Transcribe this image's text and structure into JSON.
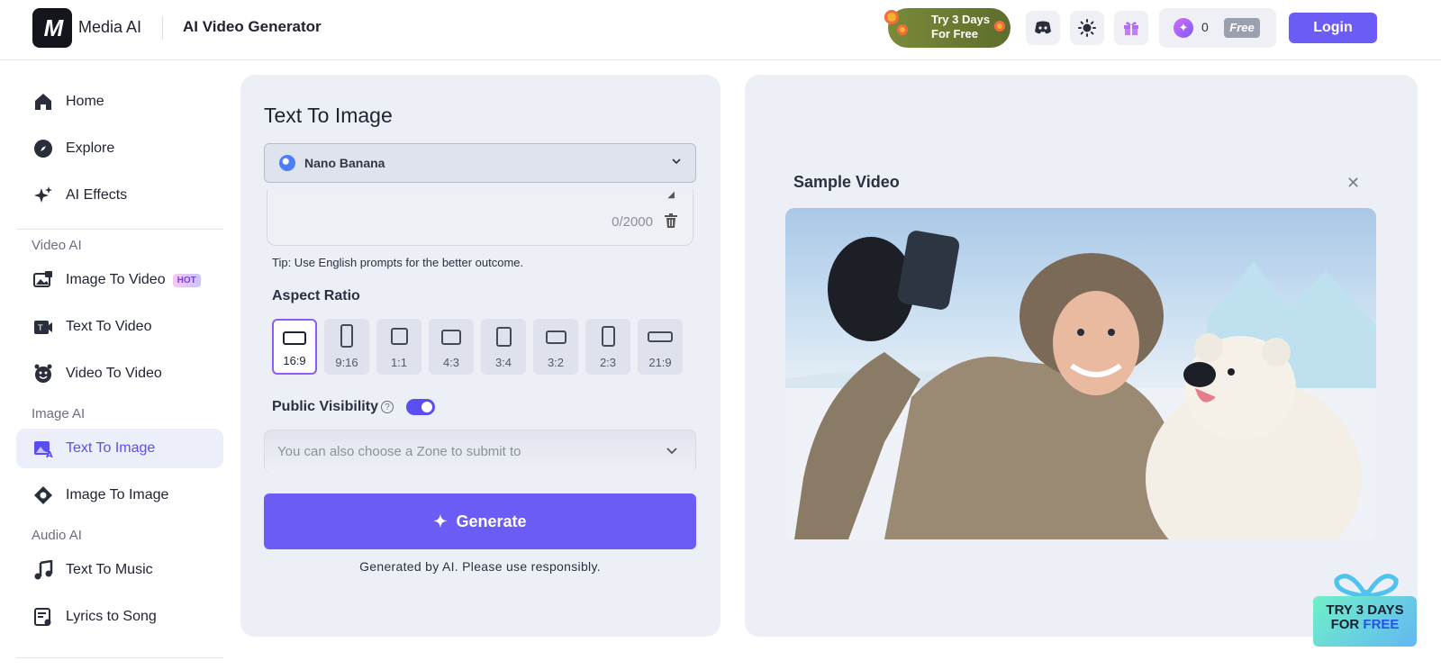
{
  "header": {
    "brand": "Media AI",
    "page_title": "AI Video Generator",
    "promo_line1": "Try 3 Days",
    "promo_line2": "For Free",
    "credits": "0",
    "plan_badge": "Free",
    "login_label": "Login"
  },
  "sidebar": {
    "items": [
      {
        "label": "Home",
        "icon": "home-icon"
      },
      {
        "label": "Explore",
        "icon": "compass-icon"
      },
      {
        "label": "AI Effects",
        "icon": "sparkles-icon"
      }
    ],
    "section_video": "Video AI",
    "video_items": [
      {
        "label": "Image To Video",
        "icon": "image-video-icon",
        "badge": "HOT"
      },
      {
        "label": "Text To Video",
        "icon": "text-video-icon"
      },
      {
        "label": "Video To Video",
        "icon": "video-video-icon"
      }
    ],
    "section_image": "Image AI",
    "image_items": [
      {
        "label": "Text To Image",
        "icon": "text-image-icon",
        "active": true
      },
      {
        "label": "Image To Image",
        "icon": "image-image-icon"
      }
    ],
    "section_audio": "Audio AI",
    "audio_items": [
      {
        "label": "Text To Music",
        "icon": "music-note-icon"
      },
      {
        "label": "Lyrics to Song",
        "icon": "lyrics-icon"
      }
    ]
  },
  "form": {
    "title": "Text To Image",
    "model": "Nano Banana",
    "counter": "0/2000",
    "tip": "Tip: Use English prompts for the better outcome.",
    "aspect_title": "Aspect Ratio",
    "aspect_ratios": [
      "16:9",
      "9:16",
      "1:1",
      "4:3",
      "3:4",
      "3:2",
      "2:3",
      "21:9"
    ],
    "aspect_selected": "16:9",
    "public_visibility_label": "Public Visibility",
    "public_visibility_on": true,
    "zone_placeholder": "You can also choose a Zone to submit to",
    "generate_label": "Generate",
    "note": "Generated by AI. Please use responsibly."
  },
  "preview": {
    "title": "Sample Video"
  },
  "float_promo": {
    "line1": "TRY 3 DAYS",
    "line2_a": "FOR ",
    "line2_b": "FREE"
  },
  "colors": {
    "accent": "#6a5cf5",
    "active_bg": "#eceef9",
    "panel_bg": "#eceff6"
  }
}
